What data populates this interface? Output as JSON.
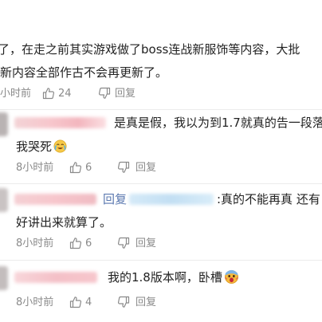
{
  "comments": [
    {
      "lines": [
        "了，在走之前其实游戏做了boss连战新服饰等内容，大批",
        "新内容全部作古不会再更新了。"
      ],
      "time": "小时前",
      "likes": "24",
      "reply": "回复"
    },
    {
      "lines": [
        "是真是假，我以为到1.7就真的告一段落",
        "我哭死"
      ],
      "emoji": "crying-laugh-emoji",
      "time": "8小时前",
      "likes": "6",
      "reply": "回复"
    },
    {
      "reply_prefix": "回复",
      "lines": [
        ":真的不能再真 还有",
        "好讲出来就算了。"
      ],
      "time": "8小时前",
      "likes": "6",
      "reply": "回复"
    },
    {
      "lines": [
        "我的1.8版本啊，卧槽"
      ],
      "emoji": "screaming-emoji",
      "time": "8小时前",
      "likes": "4",
      "reply": "回复"
    }
  ],
  "colors": {
    "text": "#222222",
    "meta": "#8a8a8a",
    "reply_word": "#5b79b0",
    "blur_pink": "#f7c6cc",
    "blur_blue": "#cfe6f6"
  }
}
